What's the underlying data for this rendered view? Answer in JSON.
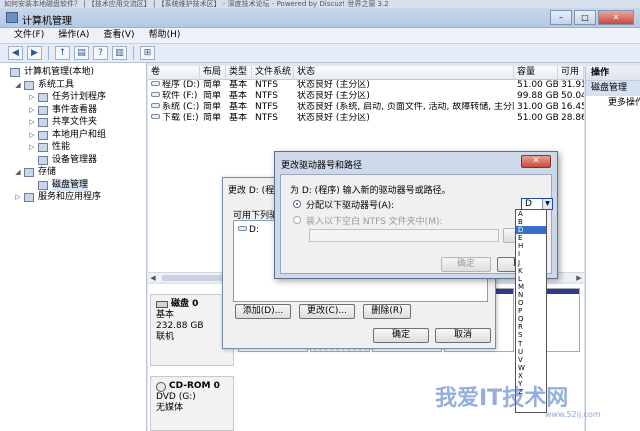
{
  "browser_strip": "如何安装本地磁盘软件？ | 【技术应用交流区】 | 【系统维护技术区】 - 深度技术论坛 - Powered by Discuz! 世界之窗 3.2",
  "window": {
    "title": "计算机管理",
    "min": "–",
    "max": "□",
    "close": "✕"
  },
  "menubar": [
    "文件(F)",
    "操作(A)",
    "查看(V)",
    "帮助(H)"
  ],
  "toolbar": [
    "◀",
    "▶",
    "↑",
    "▤",
    "?",
    "▥",
    "⊞"
  ],
  "tree": [
    {
      "label": "计算机管理(本地)",
      "level": 0,
      "arrow": ""
    },
    {
      "label": "系统工具",
      "level": 1,
      "arrow": "◢"
    },
    {
      "label": "任务计划程序",
      "level": 2,
      "arrow": "▷"
    },
    {
      "label": "事件查看器",
      "level": 2,
      "arrow": "▷"
    },
    {
      "label": "共享文件夹",
      "level": 2,
      "arrow": "▷"
    },
    {
      "label": "本地用户和组",
      "level": 2,
      "arrow": "▷"
    },
    {
      "label": "性能",
      "level": 2,
      "arrow": "▷"
    },
    {
      "label": "设备管理器",
      "level": 2,
      "arrow": ""
    },
    {
      "label": "存储",
      "level": 1,
      "arrow": "◢"
    },
    {
      "label": "磁盘管理",
      "level": 2,
      "arrow": "",
      "selected": true
    },
    {
      "label": "服务和应用程序",
      "level": 1,
      "arrow": "▷"
    }
  ],
  "volume_columns": [
    "卷",
    "布局",
    "类型",
    "文件系统",
    "状态",
    "容量",
    "可用"
  ],
  "volumes": [
    {
      "vol": "程序 (D:)",
      "layout": "简单",
      "type": "基本",
      "fs": "NTFS",
      "status": "状态良好 (主分区)",
      "capacity": "51.00 GB",
      "free": "31.91"
    },
    {
      "vol": "软件 (F:)",
      "layout": "简单",
      "type": "基本",
      "fs": "NTFS",
      "status": "状态良好 (主分区)",
      "capacity": "99.88 GB",
      "free": "50.04"
    },
    {
      "vol": "系统 (C:)",
      "layout": "简单",
      "type": "基本",
      "fs": "NTFS",
      "status": "状态良好 (系统, 启动, 页面文件, 活动, 故障转储, 主分区)",
      "capacity": "31.00 GB",
      "free": "16.45"
    },
    {
      "vol": "下载 (E:)",
      "layout": "简单",
      "type": "基本",
      "fs": "NTFS",
      "status": "状态良好 (主分区)",
      "capacity": "51.00 GB",
      "free": "28.86"
    }
  ],
  "disks": [
    {
      "name": "磁盘 0",
      "type": "基本",
      "size": "232.88 GB",
      "status": "联机"
    },
    {
      "name": "CD-ROM 0",
      "type": "DVD (G:)",
      "size": "",
      "status": "无媒体"
    }
  ],
  "actions": {
    "header": "操作",
    "section": "磁盘管理",
    "more": "更多操作"
  },
  "dialog_back": {
    "title": "更改 D: (程序",
    "access_label": "可用下列驱",
    "list_item": "D:",
    "add": "添加(D)...",
    "change": "更改(C)...",
    "remove": "删除(R)",
    "ok": "确定",
    "cancel": "取消"
  },
  "dialog_front": {
    "title": "更改驱动器号和路径",
    "close": "✕",
    "prompt": "为 D: (程序) 输入新的驱动器号或路径。",
    "option_assign": "分配以下驱动器号(A):",
    "option_mount": "装入以下空白 NTFS 文件夹中(M):",
    "drive_letter": "D",
    "browse": "浏览",
    "ok": "确定",
    "cancel": "取消"
  },
  "drive_letters": [
    "A",
    "B",
    "D",
    "E",
    "H",
    "I",
    "J",
    "K",
    "L",
    "M",
    "N",
    "O",
    "P",
    "Q",
    "R",
    "S",
    "T",
    "U",
    "V",
    "W",
    "X",
    "Y",
    "Z"
  ],
  "highlighted_letter": "D",
  "watermark": {
    "text": "我爱IT技术网",
    "url": "www.52ij.com"
  }
}
